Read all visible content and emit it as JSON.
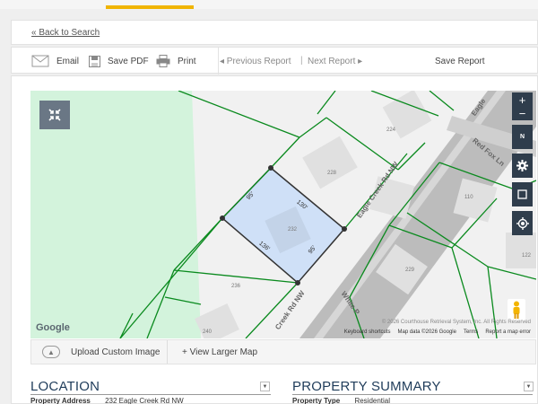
{
  "nav": {
    "back_label": "« Back to Search"
  },
  "toolbar": {
    "email": "Email",
    "save_pdf": "Save PDF",
    "print": "Print",
    "previous": "◂ Previous Report",
    "separator": "|",
    "next": "Next Report ▸",
    "save_report": "Save Report"
  },
  "map": {
    "lots": {
      "lot_224": "224",
      "lot_228": "228",
      "lot_232": "232",
      "lot_110": "110",
      "lot_229": "229",
      "lot_122": "122",
      "lot_236": "236",
      "lot_240": "240"
    },
    "dimensions": {
      "d95_left": "95'",
      "d130": "130'",
      "d136": "136'",
      "d95_right": "95'"
    },
    "roads": {
      "eagle_creek_main": "Eagle Creek Rd NW",
      "eagle_creek_lower": "Creek Rd NW",
      "eagle_top": "Eagle",
      "red_fox": "Red Fox Ln",
      "white_p": "White P"
    },
    "controls": {
      "zoom_in": "+",
      "zoom_out": "−",
      "north": "N"
    },
    "google": "Google",
    "attribution": "© 2026 Courthouse Retrieval System, Inc. All Rights Reserved",
    "keyboard": "Keyboard shortcuts",
    "map_data": "Map data ©2026 Google",
    "terms": "Terms",
    "report_error": "Report a map error",
    "selected_fill": "#cfe0f7",
    "park_fill": "#d3f3dc",
    "line_color": "#0a8a1e"
  },
  "map_actions": {
    "upload": "Upload Custom Image",
    "larger": "+ View Larger Map"
  },
  "location": {
    "title": "LOCATION",
    "address_label": "Property Address",
    "address_value": "232 Eagle Creek Rd NW"
  },
  "summary": {
    "title": "PROPERTY SUMMARY",
    "type_label": "Property Type",
    "type_value": "Residential"
  }
}
